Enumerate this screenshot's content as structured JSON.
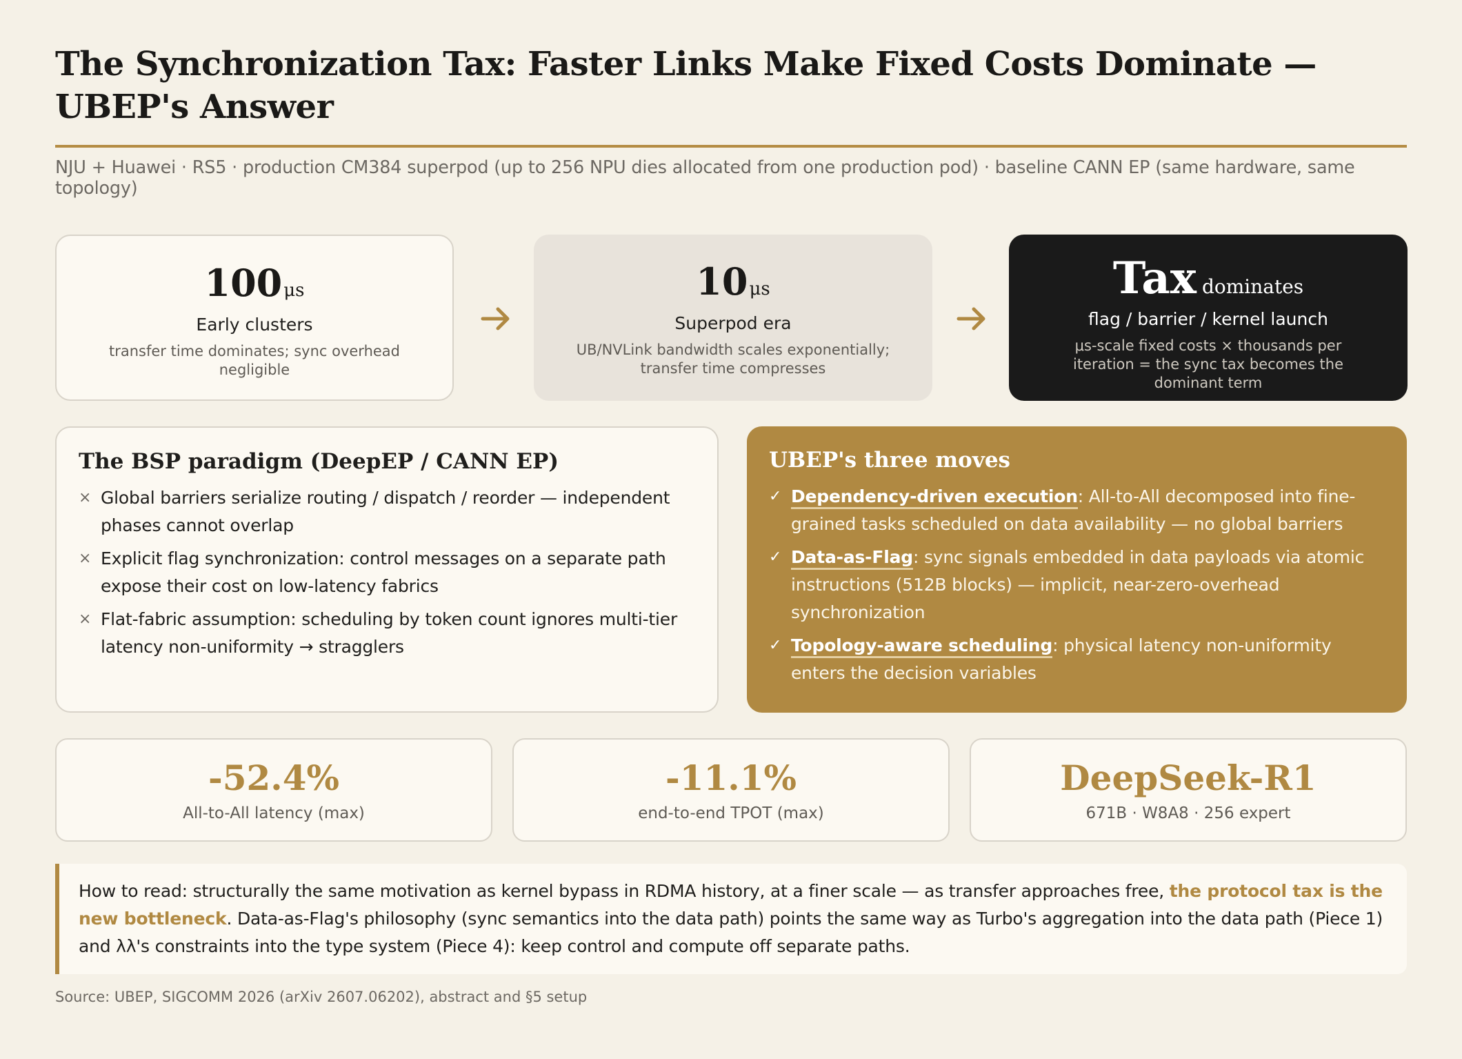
{
  "header": {
    "title": "The Synchronization Tax: Faster Links Make Fixed Costs Dominate — UBEP's Answer",
    "subtitle": "NJU + Huawei · RS5 · production CM384 superpod (up to 256 NPU dies allocated from one production pod) · baseline CANN EP (same hardware, same topology)"
  },
  "eras": [
    {
      "big": "100",
      "unit": "μs",
      "name": "Early clusters",
      "desc": "transfer time dominates; sync overhead negligible"
    },
    {
      "big": "10",
      "unit": "μs",
      "name": "Superpod era",
      "desc": "UB/NVLink bandwidth scales exponentially; transfer time compresses"
    },
    {
      "big": "Tax",
      "unit": "dominates",
      "name": "flag / barrier / kernel launch",
      "desc": "μs-scale fixed costs × thousands per iteration = the sync tax becomes the dominant term"
    }
  ],
  "bsp": {
    "title": "The BSP paradigm (DeepEP / CANN EP)",
    "mark": "×",
    "items": [
      "Global barriers serialize routing / dispatch / reorder — independent phases cannot overlap",
      "Explicit flag synchronization: control messages on a separate path expose their cost on low-latency fabrics",
      "Flat-fabric assumption: scheduling by token count ignores multi-tier latency non-uniformity → stragglers"
    ]
  },
  "ubep": {
    "title": "UBEP's three moves",
    "mark": "✓",
    "items": [
      {
        "key": "Dependency-driven execution",
        "text": ": All-to-All decomposed into fine-grained tasks scheduled on data availability — no global barriers"
      },
      {
        "key": "Data-as-Flag",
        "text": ": sync signals embedded in data payloads via atomic instructions (512B blocks) — implicit, near-zero-overhead synchronization"
      },
      {
        "key": "Topology-aware scheduling",
        "text": ": physical latency non-uniformity enters the decision variables"
      }
    ]
  },
  "stats": [
    {
      "value": "-52.4%",
      "label": "All-to-All latency (max)"
    },
    {
      "value": "-11.1%",
      "label": "end-to-end TPOT (max)"
    },
    {
      "value": "DeepSeek-R1",
      "label": "671B · W8A8 · 256 expert"
    }
  ],
  "note": {
    "before": "How to read: structurally the same motivation as kernel bypass in RDMA history, at a finer scale — as transfer approaches free, ",
    "highlight": "the protocol tax is the new bottleneck",
    "after": ". Data-as-Flag's philosophy (sync semantics into the data path) points the same way as Turbo's aggregation into the data path (Piece 1) and λλ's constraints into the type system (Piece 4): keep control and compute off separate paths."
  },
  "source": "Source: UBEP, SIGCOMM 2026 (arXiv 2607.06202), abstract and §5 setup",
  "colors": {
    "accent": "#b08942",
    "background": "#f5f1e7",
    "dark": "#1a1a1a"
  }
}
